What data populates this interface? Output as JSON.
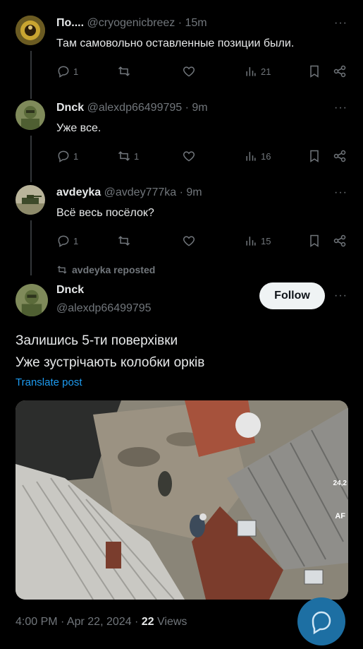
{
  "replies": [
    {
      "name": "По....",
      "handle": "@cryogenicbreez",
      "time": "· 15m",
      "text": "Там самовольно оставленные позиции были.",
      "replies": "1",
      "reposts": "",
      "views": "21"
    },
    {
      "name": "Dnck",
      "handle": "@alexdp66499795",
      "time": "· 9m",
      "text": "Уже все.",
      "replies": "1",
      "reposts": "1",
      "views": "16"
    },
    {
      "name": "avdeyka",
      "handle": "@avdey777ka",
      "time": "· 9m",
      "text": "Всё весь посёлок?",
      "replies": "1",
      "reposts": "",
      "views": "15"
    }
  ],
  "repost_label": "avdeyka reposted",
  "main_post": {
    "name": "Dnck",
    "handle": "@alexdp66499795",
    "follow_label": "Follow",
    "text_line1": "Залишись 5-ти поверхівки",
    "text_line2": "Уже зустрічають колобки орків",
    "translate_label": "Translate post",
    "video_overlay_1": "24,2",
    "video_overlay_2": "AF",
    "time": "4:00 PM · Apr 22, 2024 ·",
    "views_count": "22",
    "views_label": "Views"
  },
  "more_glyph": "···",
  "colors": {
    "background": "#000000",
    "text": "#e7e9ea",
    "muted": "#71767b",
    "link": "#1d9bf0",
    "fab": "#1d6fa3"
  }
}
